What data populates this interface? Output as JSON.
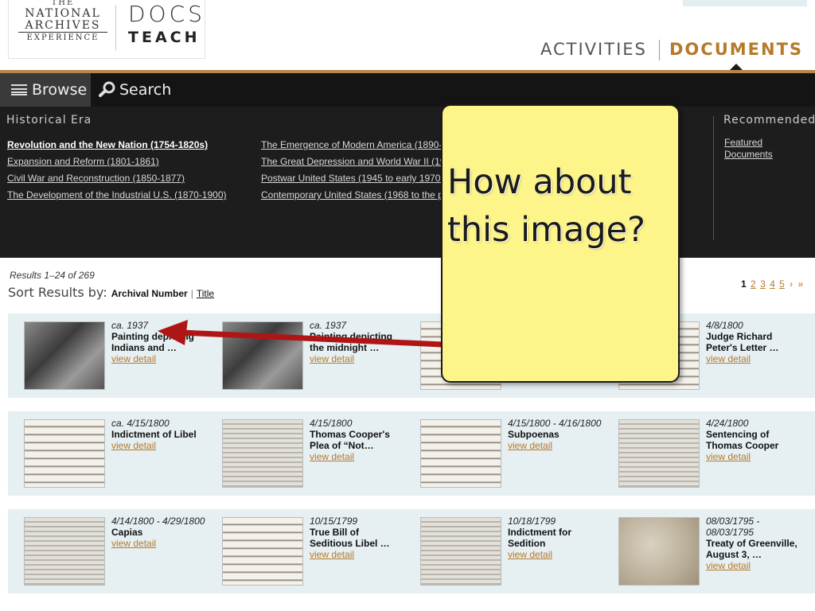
{
  "header": {
    "logo": {
      "the": "THE",
      "line1": "NATIONAL",
      "line2": "ARCHIVES",
      "line3": "EXPERIENCE",
      "docs": "DOCS",
      "teach": "TEACH"
    },
    "nav": {
      "activities": "ACTIVITIES",
      "documents": "DOCUMENTS"
    }
  },
  "browse": {
    "tab_browse": "Browse",
    "tab_search": "Search",
    "era_title": "Historical Era",
    "eras_col1": [
      "Revolution and the New Nation (1754-1820s)",
      "Expansion and Reform (1801-1861)",
      "Civil War and Reconstruction (1850-1877)",
      "The Development of the Industrial U.S. (1870-1900)"
    ],
    "eras_col2": [
      "The Emergence of Modern America (1890-1930)",
      "The Great Depression and World War II (1929-1945)",
      "Postwar United States (1945 to early 1970s)",
      "Contemporary United States (1968 to the present)"
    ],
    "recommended_title": "Recommended",
    "recommended_link": "Featured Documents"
  },
  "results": {
    "count": "Results 1–24 of 269",
    "sort_label": "Sort Results by:",
    "sort_archival": "Archival Number",
    "sort_separator": "|",
    "sort_title": "Title",
    "pager_current": "1",
    "pager_pages": [
      "2",
      "3",
      "4",
      "5"
    ],
    "pager_next": "›",
    "pager_last": "»",
    "view_detail": "view detail",
    "items": [
      {
        "date": "ca. 1937",
        "title": "Painting depicting Indians and …",
        "thumb": "photo"
      },
      {
        "date": "ca. 1937",
        "title": "Painting depicting the midnight …",
        "thumb": "photo"
      },
      {
        "date": "",
        "title": "",
        "thumb": "script"
      },
      {
        "date": "4/8/1800",
        "title": "Judge Richard Peter's Letter …",
        "thumb": "script"
      },
      {
        "date": "ca. 4/15/1800",
        "title": "Indictment of Libel",
        "thumb": "script"
      },
      {
        "date": "4/15/1800",
        "title": "Thomas Cooper's Plea of “Not…",
        "thumb": "typed"
      },
      {
        "date": "4/15/1800 - 4/16/1800",
        "title": "Subpoenas",
        "thumb": "script"
      },
      {
        "date": "4/24/1800",
        "title": "Sentencing of Thomas Cooper",
        "thumb": "typed"
      },
      {
        "date": "4/14/1800 - 4/29/1800",
        "title": "Capias",
        "thumb": "typed"
      },
      {
        "date": "10/15/1799",
        "title": "True Bill of Seditious Libel …",
        "thumb": "script"
      },
      {
        "date": "10/18/1799",
        "title": "Indictment for Sedition",
        "thumb": "typed"
      },
      {
        "date": "08/03/1795 - 08/03/1795",
        "title": "Treaty of Greenville, August 3, …",
        "thumb": "parch"
      }
    ]
  },
  "annotation": {
    "text": "How about this image?",
    "fill_color": "#fdf48a",
    "arrow_color": "#b01515"
  }
}
